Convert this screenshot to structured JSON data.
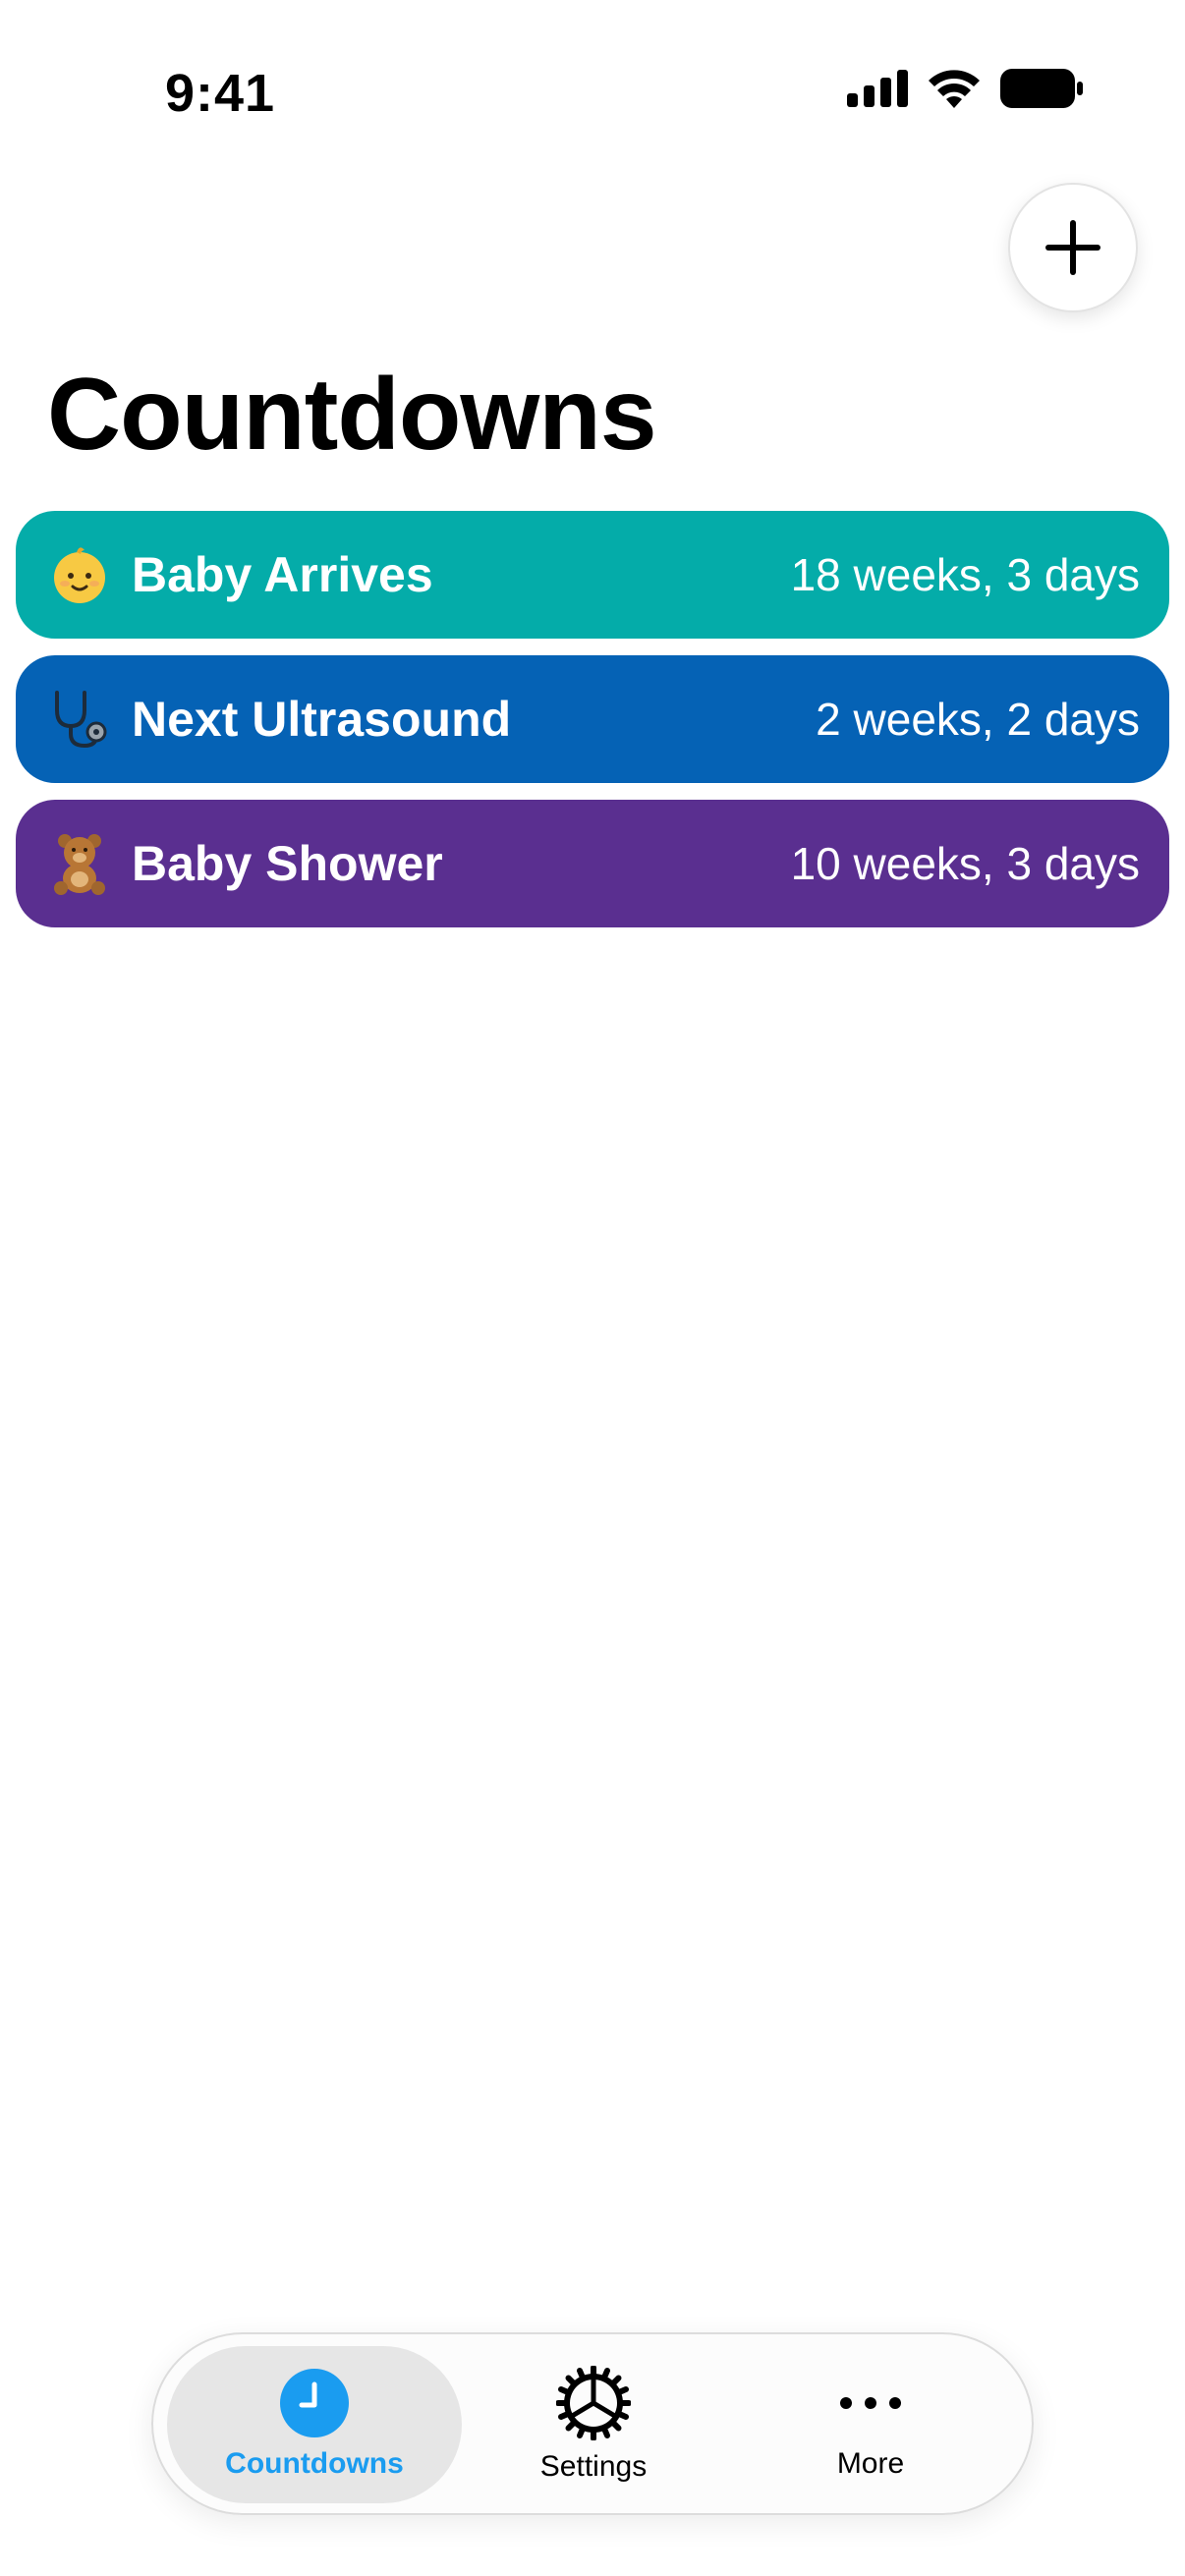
{
  "status_bar": {
    "time": "9:41"
  },
  "header": {
    "title": "Countdowns",
    "add_icon": "plus-icon"
  },
  "countdowns": [
    {
      "emoji": "👶",
      "title": "Baby Arrives",
      "remaining": "18 weeks, 3 days",
      "color": "#04ACA9"
    },
    {
      "emoji": "🩺",
      "title": "Next Ultrasound",
      "remaining": "2 weeks, 2 days",
      "color": "#0562B5"
    },
    {
      "emoji": "🧸",
      "title": "Baby Shower",
      "remaining": "10 weeks, 3 days",
      "color": "#5A2F90"
    }
  ],
  "tab_bar": {
    "selected": "Countdowns",
    "accent_color": "#1A9CF0",
    "tabs": [
      {
        "label": "Countdowns",
        "icon": "clock-icon"
      },
      {
        "label": "Settings",
        "icon": "gear-icon"
      },
      {
        "label": "More",
        "icon": "ellipsis-icon"
      }
    ]
  }
}
